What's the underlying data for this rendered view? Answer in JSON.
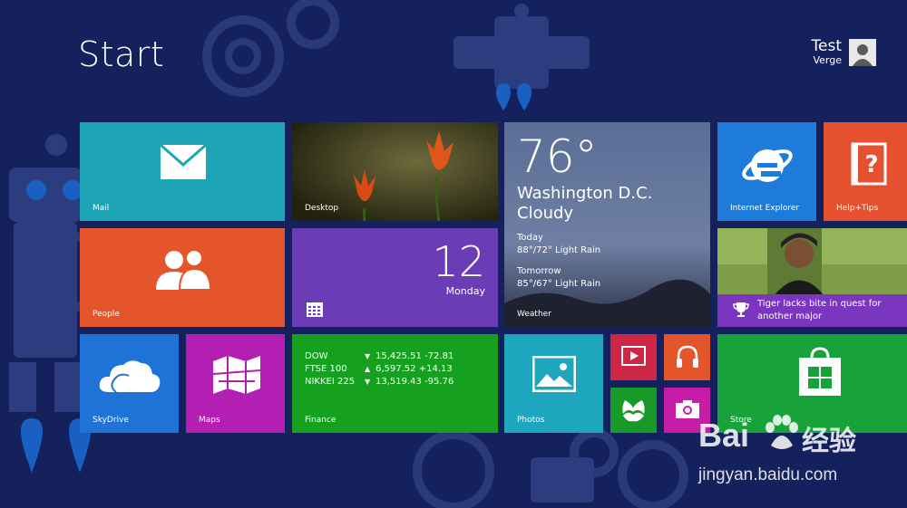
{
  "screen": {
    "title": "Start"
  },
  "user": {
    "name": "Test",
    "subtitle": "Verge"
  },
  "tiles": {
    "mail": {
      "label": "Mail"
    },
    "desktop": {
      "label": "Desktop"
    },
    "weather": {
      "label": "Weather",
      "temperature": "76°",
      "city": "Washington D.C.",
      "condition": "Cloudy",
      "today_label": "Today",
      "today_forecast": "88°/72° Light Rain",
      "tomorrow_label": "Tomorrow",
      "tomorrow_forecast": "85°/67° Light Rain"
    },
    "ie": {
      "label": "Internet Explorer"
    },
    "help": {
      "label": "Help+Tips"
    },
    "people": {
      "label": "People"
    },
    "calendar": {
      "day_number": "12",
      "day_name": "Monday"
    },
    "sports": {
      "headline": "Tiger lacks bite in quest for another major"
    },
    "skydrive": {
      "label": "SkyDrive"
    },
    "maps": {
      "label": "Maps"
    },
    "finance": {
      "label": "Finance",
      "rows": [
        {
          "name": "DOW",
          "direction": "down",
          "value": "15,425.51 -72.81"
        },
        {
          "name": "FTSE 100",
          "direction": "up",
          "value": "6,597.52 +14.13"
        },
        {
          "name": "NIKKEI 225",
          "direction": "down",
          "value": "13,519.43 -95.76"
        }
      ]
    },
    "photos": {
      "label": "Photos"
    },
    "store": {
      "label": "Store"
    }
  },
  "watermark": {
    "brand": "Bai",
    "brand_cn": "经验",
    "url": "jingyan.baidu.com"
  },
  "colors": {
    "background": "#15215c",
    "mail": "#1ea5b5",
    "people": "#e5552b",
    "calendar": "#6a3db7",
    "finance": "#15a11f",
    "store": "#17a33a",
    "maps": "#b21fb2",
    "sports_bar": "#7b36c0"
  }
}
